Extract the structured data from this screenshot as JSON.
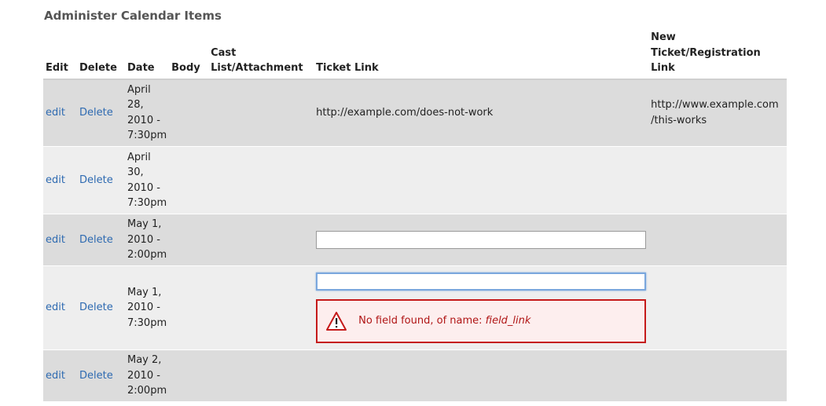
{
  "page": {
    "title": "Administer Calendar Items"
  },
  "headers": {
    "edit": "Edit",
    "delete": "Delete",
    "date": "Date",
    "body": "Body",
    "cast_line1": "Cast",
    "cast_line2": "List/Attachment",
    "ticket": "Ticket Link",
    "new_line1": "New",
    "new_line2": "Ticket/Registration",
    "new_line3": "Link"
  },
  "rows": [
    {
      "edit": "edit",
      "delete": "Delete",
      "date_lines": [
        "April",
        "28,",
        "2010 -",
        "7:30pm"
      ],
      "ticket": "http://example.com/does-not-work",
      "new_link_lines": [
        "http://www.example.com",
        "/this-works"
      ]
    },
    {
      "edit": "edit",
      "delete": "Delete",
      "date_lines": [
        "April",
        "30,",
        "2010 -",
        "7:30pm"
      ]
    },
    {
      "edit": "edit",
      "delete": "Delete",
      "date_lines": [
        "May 1,",
        "2010 -",
        "2:00pm"
      ],
      "ticket_input_value": ""
    },
    {
      "edit": "edit",
      "delete": "Delete",
      "date_lines": [
        "May 1,",
        "2010 -",
        "7:30pm"
      ],
      "ticket_input_value": "",
      "error": {
        "message": "No field found, of name: ",
        "field_name": "field_link"
      }
    },
    {
      "edit": "edit",
      "delete": "Delete",
      "date_lines": [
        "May 2,",
        "2010 -",
        "2:00pm"
      ]
    }
  ],
  "colors": {
    "link": "#2e6ab1",
    "row_dark": "#dcdcdc",
    "row_light": "#eeeeee",
    "error_border": "#c51a1a",
    "error_bg": "#fdeeee",
    "focus_ring": "#7aa7dd"
  },
  "icons": {
    "error": "warning-triangle-icon"
  }
}
